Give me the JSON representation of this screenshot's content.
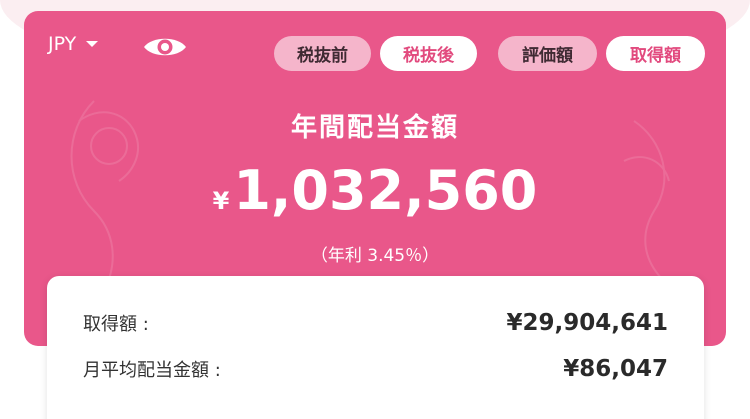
{
  "colors": {
    "hero_background": "#e9578a",
    "pill_inactive": "#f5b5cb",
    "pill_active_text": "#e24a7e",
    "page_band": "#fbeef1"
  },
  "header": {
    "currency": "JPY",
    "currency_dropdown_icon": "caret-down-icon",
    "visibility_icon": "eye-icon",
    "tax_toggle": {
      "before_tax": "税抜前",
      "after_tax": "税抜後",
      "selected": "after_tax"
    },
    "basis_toggle": {
      "valuation": "評価額",
      "acquisition": "取得額",
      "selected": "acquisition"
    }
  },
  "summary": {
    "title": "年間配当金額",
    "currency_symbol": "¥",
    "amount": "1,032,560",
    "rate_text": "（年利 3.45％）"
  },
  "details": {
    "rows": [
      {
        "label": "取得額 :",
        "value": "¥29,904,641"
      },
      {
        "label": "月平均配当金額 :",
        "value": "¥86,047"
      }
    ]
  }
}
